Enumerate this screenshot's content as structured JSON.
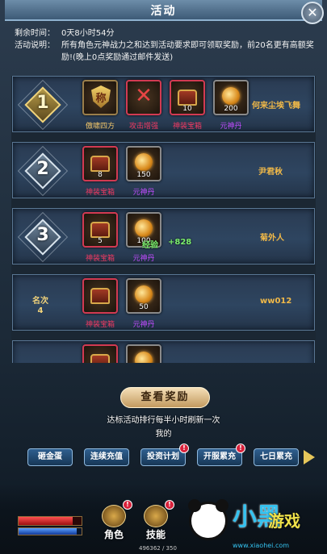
{
  "header": {
    "title": "活动",
    "close_label": "✕"
  },
  "info": {
    "remaining_label": "剩余时间：",
    "remaining_value": "0天8小时54分",
    "desc_label": "活动说明：",
    "desc_value": "所有角色元神战力之和达到活动要求即可领取奖励，前20名更有高额奖励!(晚上0点奖励通过邮件发送)"
  },
  "ranks": [
    {
      "rank": "1",
      "player": "何来尘埃飞舞",
      "rewards": [
        {
          "name": "傲啸四方",
          "count": "",
          "icon": "title-badge-icon",
          "glyph": "称",
          "color": "gold"
        },
        {
          "name": "攻击增强",
          "count": "",
          "icon": "attack-boost-icon",
          "color": "red"
        },
        {
          "name": "神装宝箱",
          "count": "10",
          "icon": "treasure-chest-icon",
          "color": "red"
        },
        {
          "name": "元神丹",
          "count": "200",
          "icon": "spirit-pill-icon",
          "color": "purple"
        }
      ]
    },
    {
      "rank": "2",
      "player": "尹君秋",
      "rewards": [
        {
          "name": "神装宝箱",
          "count": "8",
          "icon": "treasure-chest-icon",
          "color": "red"
        },
        {
          "name": "元神丹",
          "count": "150",
          "icon": "spirit-pill-icon",
          "color": "purple"
        }
      ]
    },
    {
      "rank": "3",
      "player": "菊外人",
      "rewards": [
        {
          "name": "神装宝箱",
          "count": "5",
          "icon": "treasure-chest-icon",
          "color": "red"
        },
        {
          "name": "元神丹",
          "count": "100",
          "icon": "spirit-pill-icon",
          "color": "purple"
        }
      ]
    },
    {
      "rank_label": "名次",
      "rank_value": "4",
      "player": "ww012",
      "rewards": [
        {
          "name": "神装宝箱",
          "count": "",
          "icon": "treasure-chest-icon",
          "color": "red"
        },
        {
          "name": "元神丹",
          "count": "50",
          "icon": "spirit-pill-icon",
          "color": "purple"
        }
      ]
    }
  ],
  "float_text": {
    "label": "经验",
    "value": "+828"
  },
  "actions": {
    "view_rewards": "查看奖励",
    "refresh_note": "达标活动排行每半小时刷新一次",
    "my_rank_label": "我的"
  },
  "tabs": [
    {
      "label": "砸金蛋",
      "badge": false
    },
    {
      "label": "连续充值",
      "badge": false
    },
    {
      "label": "投资计划",
      "badge": true
    },
    {
      "label": "开服累充",
      "badge": true
    },
    {
      "label": "七日累充",
      "badge": false
    }
  ],
  "hud": {
    "buttons": [
      {
        "label": "角色",
        "badge": true
      },
      {
        "label": "技能",
        "badge": true
      }
    ],
    "hp_fraction": 0.86,
    "mp_fraction": 0.92,
    "xp_text": "496362 / 350"
  },
  "watermark": {
    "main": "小黑",
    "accent": "游戏",
    "url": "www.xiaohei.com"
  },
  "colors": {
    "accent_gold": "#f3c76a",
    "badge_red": "#d8203a",
    "tab_blue": "#2f5f8f"
  }
}
